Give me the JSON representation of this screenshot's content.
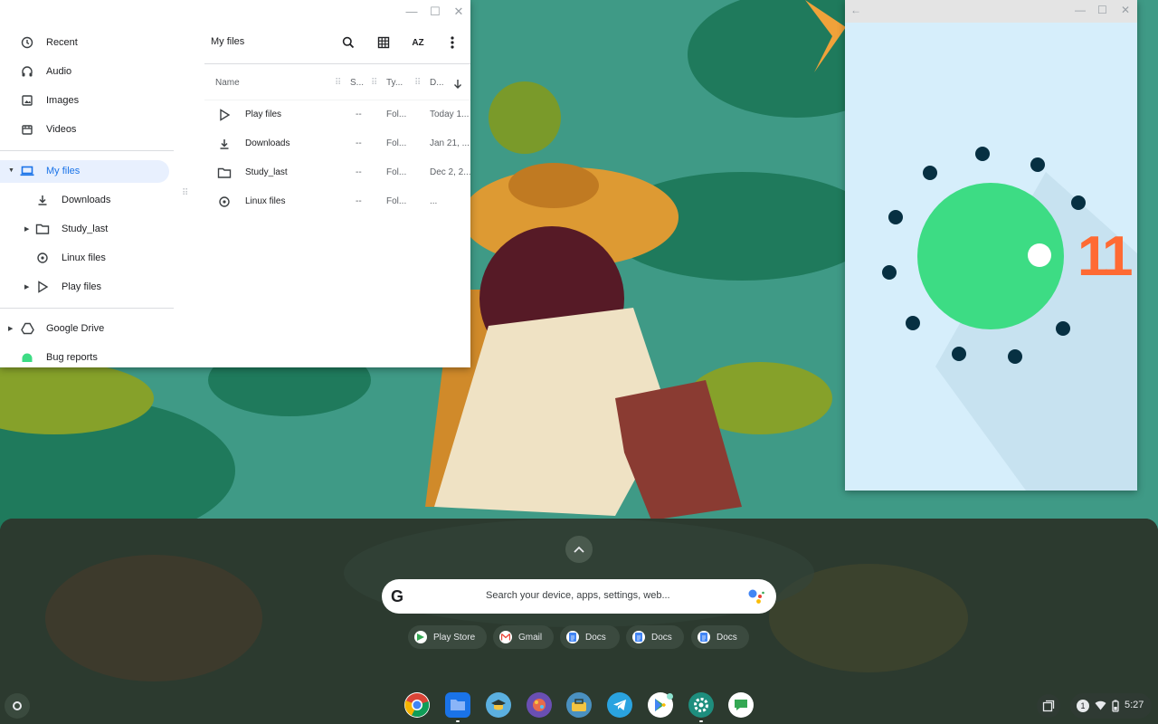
{
  "files_window": {
    "title": "My files",
    "controls": {
      "minimize": "—",
      "maximize": "☐",
      "close": "✕"
    },
    "sidebar": {
      "recent": "Recent",
      "audio": "Audio",
      "images": "Images",
      "videos": "Videos",
      "my_files": "My files",
      "downloads": "Downloads",
      "study_last": "Study_last",
      "linux_files": "Linux files",
      "play_files": "Play files",
      "google_drive": "Google Drive",
      "bug_reports": "Bug reports"
    },
    "toolbar": {
      "sort_label": "AZ"
    },
    "columns": {
      "name": "Name",
      "size": "S...",
      "type": "Ty...",
      "date": "D..."
    },
    "rows": [
      {
        "name": "Play files",
        "size": "--",
        "type": "Fol...",
        "date": "Today 1..."
      },
      {
        "name": "Downloads",
        "size": "--",
        "type": "Fol...",
        "date": "Jan 21, ..."
      },
      {
        "name": "Study_last",
        "size": "--",
        "type": "Fol...",
        "date": "Dec 2, 2..."
      },
      {
        "name": "Linux files",
        "size": "--",
        "type": "Fol...",
        "date": "..."
      }
    ]
  },
  "android_window": {
    "controls": {
      "back": "←",
      "minimize": "—",
      "maximize": "☐",
      "close": "✕"
    },
    "logo_text": "11"
  },
  "launcher": {
    "search_placeholder": "Search your device, apps, settings, web...",
    "google_letter": "G",
    "suggestions": [
      {
        "label": "Play Store"
      },
      {
        "label": "Gmail"
      },
      {
        "label": "Docs"
      },
      {
        "label": "Docs"
      },
      {
        "label": "Docs"
      }
    ]
  },
  "shelf": {
    "apps": [
      "Chrome",
      "Files",
      "Classroom",
      "Art app",
      "Toolbox",
      "Telegram",
      "Play Store",
      "Settings",
      "Google Chat"
    ],
    "tray": {
      "notification_count": "1",
      "time": "5:27"
    }
  },
  "colors": {
    "accent": "#1a73e8",
    "android_green": "#3ddc84",
    "android_orange": "#ff6a33",
    "dot_dark": "#073042"
  }
}
